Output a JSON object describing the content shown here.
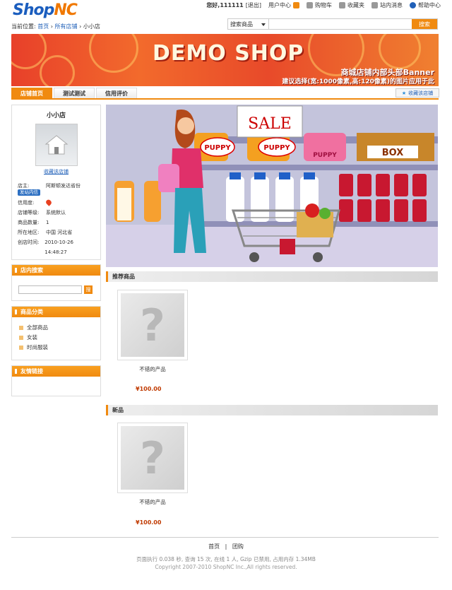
{
  "header": {
    "logo_main": "Shop",
    "logo_accent": "NC",
    "greeting": "您好,111111",
    "logout": "[退出]",
    "user_center": "用户中心",
    "cart": "购物车",
    "favorites": "收藏夹",
    "messages": "站内消息",
    "help": "帮助中心"
  },
  "breadcrumb": {
    "prefix": "当前位置:",
    "home": "首页",
    "all_shops": "所有店铺",
    "current": "小小店",
    "sep": "›"
  },
  "search": {
    "type_selected": "搜索商品",
    "value": "",
    "button": "搜索"
  },
  "banner": {
    "title": "DEMO SHOP",
    "line1": "商城店铺内部头部Banner",
    "line2": "建议选择(宽:1000像素,高:120像素)的图片应用于此"
  },
  "tabs": [
    {
      "label": "店铺首页",
      "active": true
    },
    {
      "label": "测试测试",
      "active": false
    },
    {
      "label": "信用评价",
      "active": false
    }
  ],
  "fav_shop_btn": "收藏该店铺",
  "shop": {
    "name": "小小店",
    "fav_link": "收藏该店铺",
    "owner_label": "店主:",
    "owner": "阿斯顿发达省份",
    "msg_btn": "发站内信",
    "credit_label": "信用度:",
    "grade_label": "店铺等级:",
    "grade": "系统默认",
    "count_label": "商品数量:",
    "count": "1",
    "region_label": "所在地区:",
    "region": "中国 河北省",
    "created_label": "创店时间:",
    "created": "2010-10-26 14:48:27"
  },
  "search_panel": {
    "title": "店内搜索",
    "value": "",
    "button": "搜"
  },
  "category_panel": {
    "title": "商品分类",
    "items": [
      "全部商品",
      "女装",
      "时尚服装"
    ]
  },
  "links_panel": {
    "title": "友情链接"
  },
  "sale_sign": "SALE",
  "shelf_labels": [
    "PUPPY",
    "PUPPY",
    "PUPPY",
    "BOX"
  ],
  "recommend": {
    "title": "推荐商品",
    "product_name": "不错的产品",
    "price": "¥100.00"
  },
  "new": {
    "title": "新品",
    "product_name": "不错的产品",
    "price": "¥100.00"
  },
  "footer": {
    "home": "首页",
    "sep": "|",
    "group": "团购",
    "stats": "页面执行 0.038 秒, 查询 15 次, 在线 1 人, Gzip 已禁用, 占用内存 1.34MB",
    "copyright": "Copyright 2007-2010 ShopNC Inc.,All rights reserved."
  }
}
